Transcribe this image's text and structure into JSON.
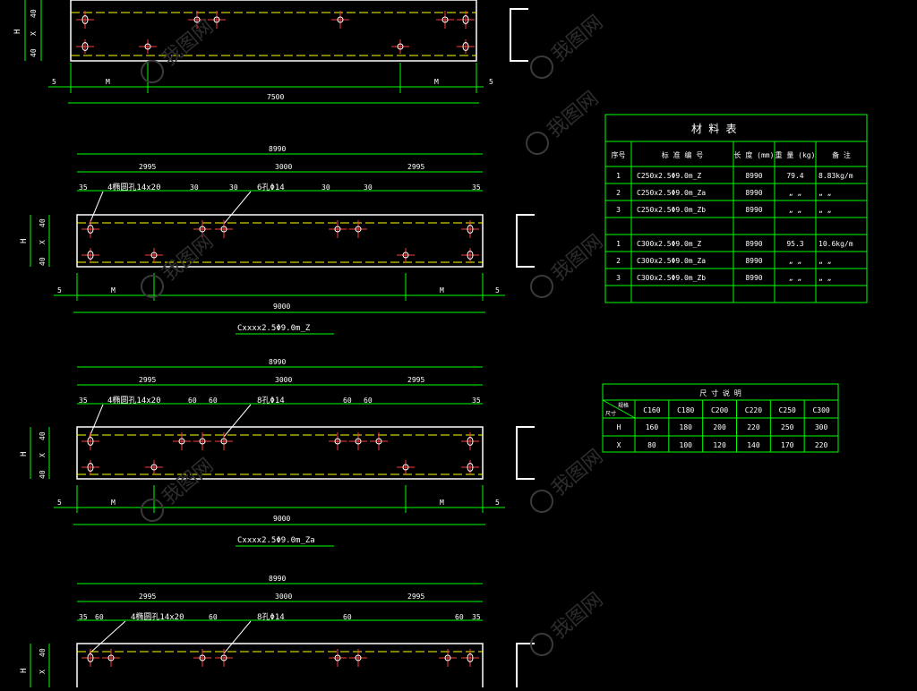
{
  "top_fragment": {
    "dims_left": [
      "40",
      "X",
      "40"
    ],
    "dim_h": "H",
    "dim_m": "M",
    "dim_5": "5",
    "total": "7500"
  },
  "views": [
    {
      "overall": "8990",
      "segments": [
        "2995",
        "3000",
        "2995"
      ],
      "edge": "35",
      "spacing_a": "30",
      "spacing_b": "30",
      "spacing_c": "30",
      "spacing_d": "30",
      "slot_label": "4椭圆孔14x20",
      "hole_label": "6孔Φ14",
      "dims_left": [
        "40",
        "X",
        "40"
      ],
      "dim_h": "H",
      "dim_m": "M",
      "dim_5": "5",
      "bottom_total": "9000",
      "caption": "Cxxxx2.5Φ9.0m_Z"
    },
    {
      "overall": "8990",
      "segments": [
        "2995",
        "3000",
        "2995"
      ],
      "edge": "35",
      "spacing_a": "60",
      "spacing_b": "60",
      "spacing_c": "60",
      "spacing_d": "60",
      "slot_label": "4椭圆孔14x20",
      "hole_label": "8孔Φ14",
      "dims_left": [
        "40",
        "X",
        "40"
      ],
      "dim_h": "H",
      "dim_m": "M",
      "dim_5": "5",
      "bottom_total": "9000",
      "caption": "Cxxxx2.5Φ9.0m_Za"
    },
    {
      "overall": "8990",
      "segments": [
        "2995",
        "3000",
        "2995"
      ],
      "edge": "35",
      "spacing_a": "60",
      "spacing_b": "60",
      "spacing_c": "60",
      "spacing_d": "60",
      "slot_label": "4椭圆孔14x20",
      "hole_label": "8孔Φ14",
      "dims_left": [
        "40",
        "X"
      ],
      "dim_h": "H"
    }
  ],
  "material_table": {
    "title": "材      料      表",
    "headers": [
      "序号",
      "标 准 编 号",
      "长 度 (mm)",
      "重 量 (kg)",
      "备 注"
    ],
    "rows": [
      [
        "1",
        "C250x2.5Φ9.0m_Z",
        "8990",
        "79.4",
        "8.83kg/m"
      ],
      [
        "2",
        "C250x2.5Φ9.0m_Za",
        "8990",
        "„ „",
        "„ „"
      ],
      [
        "3",
        "C250x2.5Φ9.0m_Zb",
        "8990",
        "„ „",
        "„ „"
      ],
      [
        "",
        "",
        "",
        "",
        ""
      ],
      [
        "1",
        "C300x2.5Φ9.0m_Z",
        "8990",
        "95.3",
        "10.6kg/m"
      ],
      [
        "2",
        "C300x2.5Φ9.0m_Za",
        "8990",
        "„ „",
        "„ „"
      ],
      [
        "3",
        "C300x2.5Φ9.0m_Zb",
        "8990",
        "„ „",
        "„ „"
      ],
      [
        "",
        "",
        "",
        "",
        ""
      ]
    ]
  },
  "size_table": {
    "title": "尺 寸 说 明",
    "corner_top": "规格",
    "corner_bottom": "尺寸",
    "headers": [
      "C160",
      "C180",
      "C200",
      "C220",
      "C250",
      "C300"
    ],
    "rows": [
      {
        "label": "H",
        "values": [
          "160",
          "180",
          "200",
          "220",
          "250",
          "300"
        ]
      },
      {
        "label": "X",
        "values": [
          "80",
          "100",
          "120",
          "140",
          "170",
          "220"
        ]
      }
    ]
  },
  "watermark": "我图网",
  "colors": {
    "background": "#000000",
    "lines": "#ffffff",
    "dimension": "#00ff00",
    "holes": "#ff3b3b",
    "centerline": "#ff3b3b",
    "yellow": "#ffff00",
    "table": "#00ff00"
  }
}
